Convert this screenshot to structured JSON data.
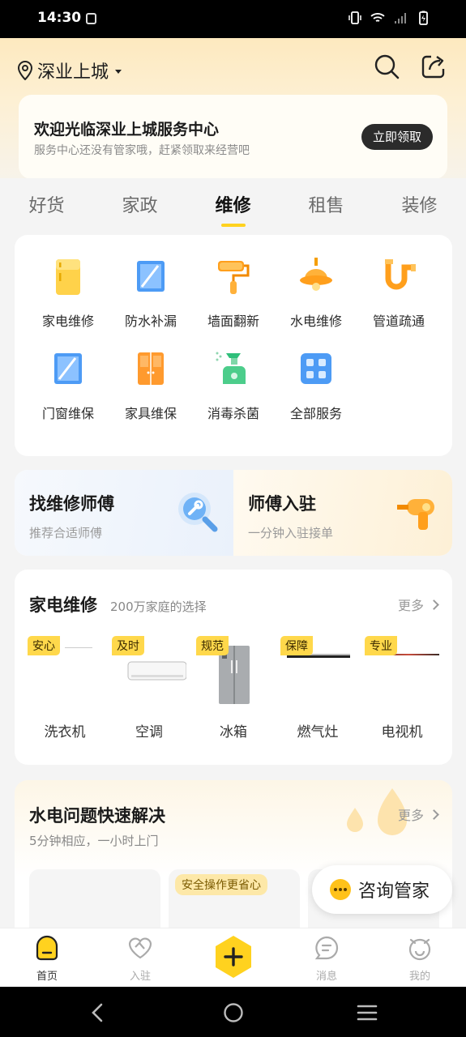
{
  "status": {
    "time": "14:30"
  },
  "header": {
    "location": "深业上城"
  },
  "welcome": {
    "title": "欢迎光临深业上城服务中心",
    "subtitle": "服务中心还没有管家哦，赶紧领取来经营吧",
    "button": "立即领取"
  },
  "tabs": [
    "好货",
    "家政",
    "维修",
    "租售",
    "装修"
  ],
  "services": [
    {
      "label": "家电维修",
      "icon": "fridge-icon"
    },
    {
      "label": "防水补漏",
      "icon": "window-icon"
    },
    {
      "label": "墙面翻新",
      "icon": "paint-roller-icon"
    },
    {
      "label": "水电维修",
      "icon": "lamp-icon"
    },
    {
      "label": "管道疏通",
      "icon": "pipe-icon"
    },
    {
      "label": "门窗维保",
      "icon": "window-icon"
    },
    {
      "label": "家具维保",
      "icon": "cabinet-icon"
    },
    {
      "label": "消毒杀菌",
      "icon": "spray-icon"
    },
    {
      "label": "全部服务",
      "icon": "grid-icon"
    }
  ],
  "promo": {
    "left": {
      "title": "找维修师傅",
      "subtitle": "推荐合适师傅"
    },
    "right": {
      "title": "师傅入驻",
      "subtitle": "一分钟入驻接单"
    }
  },
  "appliance": {
    "title": "家电维修",
    "subtitle": "200万家庭的选择",
    "more": "更多",
    "items": [
      {
        "tag": "安心",
        "name": "洗衣机"
      },
      {
        "tag": "及时",
        "name": "空调"
      },
      {
        "tag": "规范",
        "name": "冰箱"
      },
      {
        "tag": "保障",
        "name": "燃气灶"
      },
      {
        "tag": "专业",
        "name": "电视机"
      }
    ]
  },
  "water": {
    "title": "水电问题快速解决",
    "subtitle": "5分钟相应，一小时上门",
    "more": "更多",
    "card_tag": "安全操作更省心"
  },
  "consult": {
    "label": "咨询管家"
  },
  "bottom_nav": [
    "首页",
    "入驻",
    "消息",
    "我的"
  ],
  "colors": {
    "accent": "#ffd21f",
    "dark_button": "#2b2b2b"
  }
}
